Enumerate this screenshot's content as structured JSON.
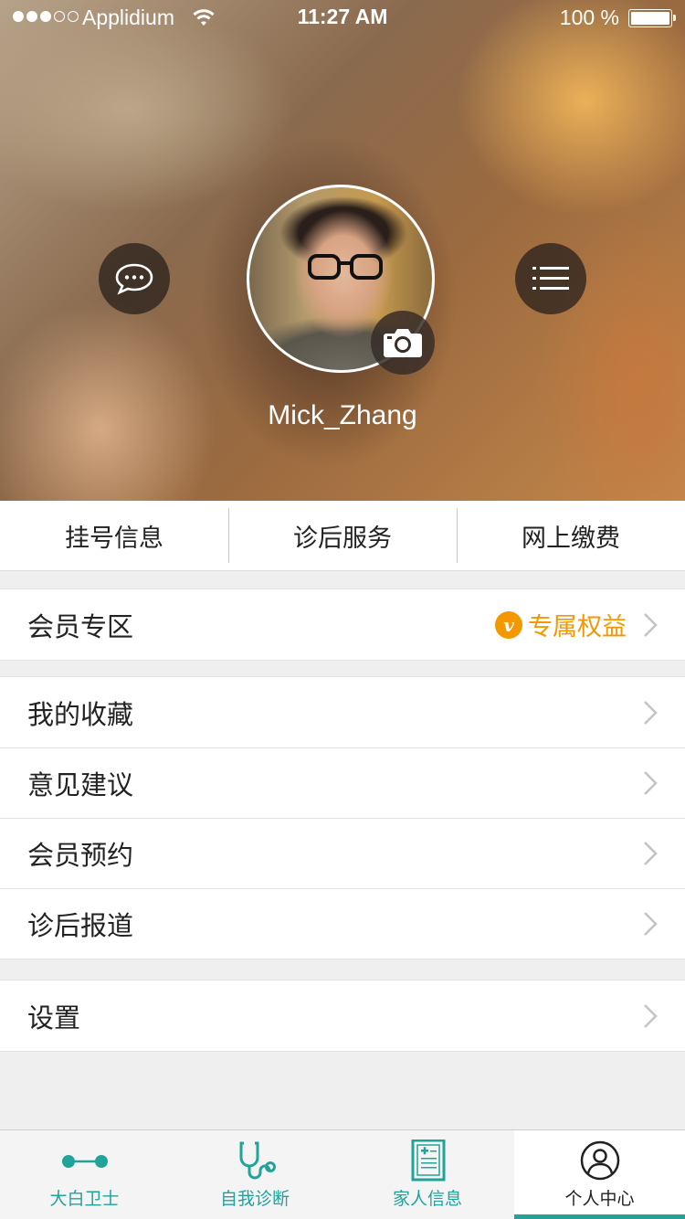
{
  "status_bar": {
    "carrier": "Applidium",
    "time": "11:27 AM",
    "battery": "100 %"
  },
  "profile": {
    "username": "Mick_Zhang",
    "icons": [
      "chat-bubble-icon",
      "list-menu-icon",
      "camera-icon"
    ]
  },
  "quick_tabs": [
    {
      "label": "挂号信息"
    },
    {
      "label": "诊后服务"
    },
    {
      "label": "网上缴费"
    }
  ],
  "member": {
    "label": "会员专区",
    "badge_letter": "v",
    "badge_text": "专属权益",
    "accent": "#f39800"
  },
  "menu": [
    {
      "label": "我的收藏"
    },
    {
      "label": "意见建议"
    },
    {
      "label": "会员预约"
    },
    {
      "label": "诊后报道"
    }
  ],
  "settings": {
    "label": "设置"
  },
  "tabbar": {
    "accent": "#22a39a",
    "items": [
      {
        "label": "大白卫士",
        "icon": "guard-link-icon"
      },
      {
        "label": "自我诊断",
        "icon": "stethoscope-icon"
      },
      {
        "label": "家人信息",
        "icon": "medical-record-icon"
      },
      {
        "label": "个人中心",
        "icon": "person-icon",
        "active": true
      }
    ]
  }
}
